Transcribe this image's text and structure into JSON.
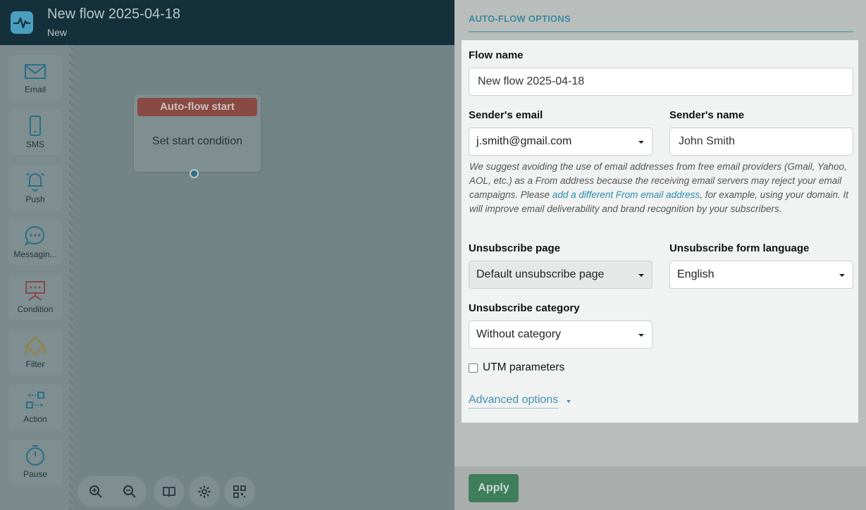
{
  "header": {
    "title": "New flow 2025-04-18",
    "status": "New"
  },
  "toolbox": [
    {
      "label": "Email",
      "icon": "email-icon"
    },
    {
      "label": "SMS",
      "icon": "phone-icon"
    },
    {
      "label": "Push",
      "icon": "bell-icon"
    },
    {
      "label": "Messagin...",
      "icon": "chat-icon"
    },
    {
      "label": "Condition",
      "icon": "condition-icon"
    },
    {
      "label": "Filter",
      "icon": "filter-icon"
    },
    {
      "label": "Action",
      "icon": "action-icon"
    },
    {
      "label": "Pause",
      "icon": "clock-icon"
    }
  ],
  "start_node": {
    "header": "Auto-flow start",
    "body": "Set start condition"
  },
  "bottom_toolbar": [
    "zoom-in-icon",
    "zoom-out-icon",
    "book-icon",
    "gear-icon",
    "qr-icon"
  ],
  "panel": {
    "title": "AUTO-FLOW OPTIONS",
    "flow_name_label": "Flow name",
    "flow_name_value": "New flow 2025-04-18",
    "sender_email_label": "Sender's email",
    "sender_email_value": "j.smith@gmail.com",
    "sender_name_label": "Sender's name",
    "sender_name_value": "John Smith",
    "note_part1": "We suggest avoiding the use of email addresses from free email providers (Gmail, Yahoo, AOL, etc.) as a From address because the receiving email servers may reject your email campaigns. Please ",
    "note_link": "add a different From email address",
    "note_part2": ", for example, using your domain. It will improve email deliverability and brand recognition by your subscribers.",
    "unsub_page_label": "Unsubscribe page",
    "unsub_page_value": "Default unsubscribe page",
    "unsub_lang_label": "Unsubscribe form language",
    "unsub_lang_value": "English",
    "unsub_cat_label": "Unsubscribe category",
    "unsub_cat_value": "Without category",
    "utm_label": "UTM parameters",
    "advanced_label": "Advanced options",
    "apply_label": "Apply"
  },
  "colors": {
    "header_bg": "#14303a",
    "accent_teal": "#3f8a9e",
    "start_red": "#8a4a44",
    "apply_green": "#3f7e5b"
  }
}
